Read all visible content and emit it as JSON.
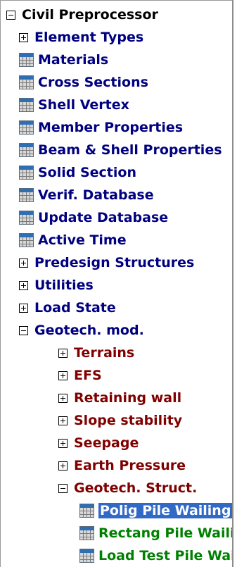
{
  "tree": {
    "root": {
      "label": "Civil Preprocessor",
      "expanded": true
    },
    "items": [
      {
        "label": "Element Types",
        "kind": "folder",
        "expanded": false
      },
      {
        "label": "Materials",
        "kind": "table"
      },
      {
        "label": "Cross Sections",
        "kind": "table"
      },
      {
        "label": "Shell Vertex",
        "kind": "table"
      },
      {
        "label": "Member Properties",
        "kind": "table"
      },
      {
        "label": "Beam & Shell Properties",
        "kind": "table"
      },
      {
        "label": "Solid Section",
        "kind": "table"
      },
      {
        "label": "Verif. Database",
        "kind": "table"
      },
      {
        "label": "Update Database",
        "kind": "table"
      },
      {
        "label": "Active Time",
        "kind": "table"
      },
      {
        "label": "Predesign Structures",
        "kind": "folder",
        "expanded": false
      },
      {
        "label": "Utilities",
        "kind": "folder",
        "expanded": false
      },
      {
        "label": "Load State",
        "kind": "folder",
        "expanded": false
      },
      {
        "label": "Geotech. mod.",
        "kind": "folder",
        "expanded": true
      }
    ],
    "geotech_children": [
      {
        "label": "Terrains",
        "expanded": false
      },
      {
        "label": "EFS",
        "expanded": false
      },
      {
        "label": "Retaining wall",
        "expanded": false
      },
      {
        "label": "Slope stability",
        "expanded": false
      },
      {
        "label": "Seepage",
        "expanded": false
      },
      {
        "label": "Earth Pressure",
        "expanded": false
      },
      {
        "label": "Geotech. Struct.",
        "expanded": true
      }
    ],
    "geotech_struct_children": [
      {
        "label": "Polig Pile Wailing",
        "selected": true
      },
      {
        "label": "Rectang Pile Wailing",
        "selected": false
      },
      {
        "label": "Load Test Pile Wailing",
        "selected": false
      }
    ],
    "colors": {
      "root": "#000000",
      "level1": "#000080",
      "level2": "#800000",
      "level3": "#008000",
      "selection": "#3169c6"
    }
  }
}
